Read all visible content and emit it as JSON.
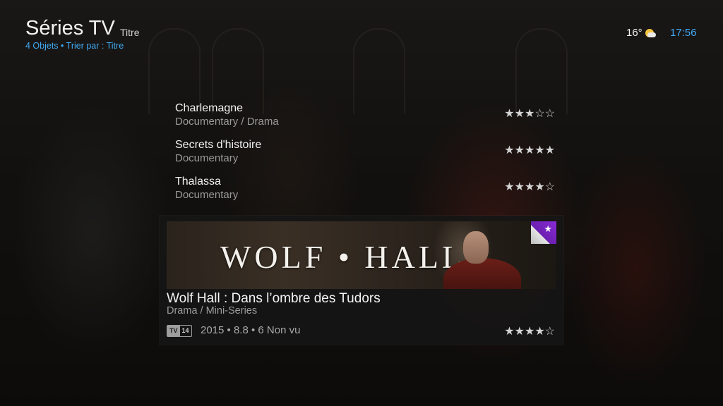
{
  "header": {
    "title": "Séries TV",
    "subtitle": "Titre",
    "meta": "4 Objets • Trier par : Titre"
  },
  "status": {
    "temperature": "16°",
    "weather_icon": "partly-sunny-icon",
    "clock": "17:56"
  },
  "list": [
    {
      "title": "Charlemagne",
      "genre": "Documentary / Drama",
      "stars": "★★★☆☆",
      "rating": 3
    },
    {
      "title": "Secrets d'histoire",
      "genre": "Documentary",
      "stars": "★★★★★",
      "rating": 5
    },
    {
      "title": "Thalassa",
      "genre": "Documentary",
      "stars": "★★★★☆",
      "rating": 4
    }
  ],
  "selected": {
    "banner_text": "WOLF • HALL",
    "title": "Wolf Hall : Dans l’ombre des Tudors",
    "genre": "Drama / Mini-Series",
    "tv_rating_prefix": "TV",
    "tv_rating_value": "14",
    "info": "2015 • 8.8 • 6 Non vu",
    "stars": "★★★★☆",
    "rating": 4,
    "corner_icon": "star-icon"
  },
  "colors": {
    "accent": "#3fa9f5",
    "corner_badge": "#8a2ad6"
  }
}
